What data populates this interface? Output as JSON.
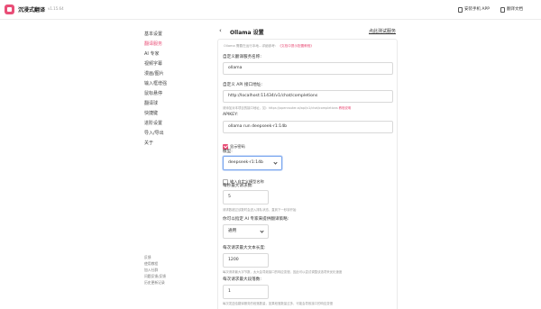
{
  "header": {
    "brand": "沉浸式翻译",
    "version": "v1.15.64",
    "install_app": "安装手机 APP",
    "docs": "翻译文档"
  },
  "sidebar": {
    "items": [
      {
        "label": "基本设置",
        "active": false
      },
      {
        "label": "翻译服务",
        "active": true
      },
      {
        "label": "AI 专家",
        "active": false
      },
      {
        "label": "视频字幕",
        "active": false
      },
      {
        "label": "漫画/图片",
        "active": false
      },
      {
        "label": "输入框增强",
        "active": false
      },
      {
        "label": "鼠标悬停",
        "active": false
      },
      {
        "label": "翻译球",
        "active": false
      },
      {
        "label": "快捷键",
        "active": false
      },
      {
        "label": "进阶设置",
        "active": false
      },
      {
        "label": "导入/导出",
        "active": false
      },
      {
        "label": "关于",
        "active": false
      }
    ],
    "links": [
      "反馈",
      "使用教程",
      "加入社群",
      "问题反馈/反馈",
      "历史更新记录"
    ]
  },
  "main": {
    "back_glyph": "‹",
    "title": "Ollama 设置",
    "test_link": "点此测试服务",
    "notice_prefix": "Ollama 需要在运行本地...详细参考：",
    "notice_link": "《文档中提示配置教程》",
    "name_label": "自定义翻译服务名称:",
    "name_value": "ollama",
    "api_label": "自定义 API 接口地址:",
    "api_value": "http://localhost:11434/v1/chat/completions",
    "api_hint_prefix": "请添加对本项目的接口地址，如：https://openrouter.ai/api/v1/chat/completions",
    "api_hint_link": "教程说明",
    "apikey_label": "APIKEY:",
    "apikey_value": "ollama run deepseek-r1:14b",
    "show_password": "显示密码",
    "model_label": "模型:",
    "model_value": "deepseek-r1:14b",
    "custom_model_label": "输入自定义模型名称",
    "rps_label": "每秒最大请求数:",
    "rps_value": "5",
    "rps_hint": "请求数超过该数时会进入排队状态，直到下一秒钟开始",
    "ai_expert_label": "你可以指定 AI 专家来提供翻译策略:",
    "ai_expert_value": "通用",
    "max_text_label": "每次请求最大文本长度:",
    "max_text_value": "1200",
    "max_text_hint": "每次请求最大字节数，太大会导致接口的响应变慢，因此可以尝试调整该选项来优化速度",
    "max_para_label": "每次请求最大段落数:",
    "max_para_value": "1",
    "max_para_hint": "每次发送给翻译服务的段落数量，如果段落数量过多，可能会导致接口的响应变慢"
  },
  "colors": {
    "accent": "#e94e77",
    "focus": "#7aa6ef"
  }
}
